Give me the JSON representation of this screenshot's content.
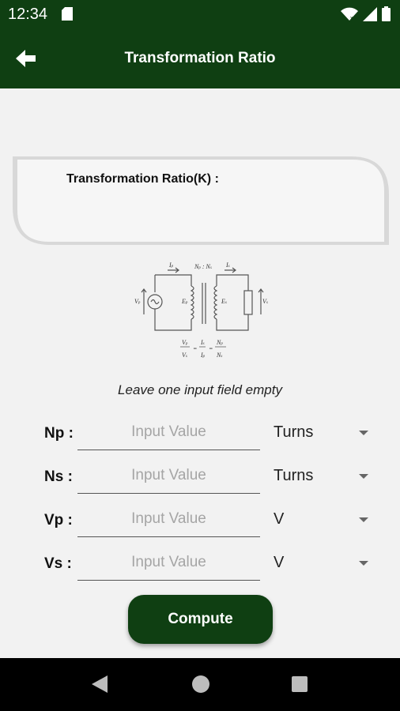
{
  "status_bar": {
    "time": "12:34"
  },
  "app_bar": {
    "title": "Transformation Ratio"
  },
  "result": {
    "label": "Transformation Ratio(K) :",
    "value": ""
  },
  "hint": "Leave one input field empty",
  "fields": [
    {
      "label": "Np :",
      "placeholder": "Input Value",
      "unit": "Turns"
    },
    {
      "label": "Ns :",
      "placeholder": "Input Value",
      "unit": "Turns"
    },
    {
      "label": "Vp :",
      "placeholder": "Input Value",
      "unit": "V"
    },
    {
      "label": "Vs :",
      "placeholder": "Input Value",
      "unit": "V"
    }
  ],
  "compute_label": "Compute",
  "colors": {
    "primary": "#0f3f12",
    "background": "#f2f2f2",
    "card": "#f5f5f5"
  },
  "icons": {
    "back": "arrow-left-icon",
    "wifi": "wifi-icon",
    "signal": "signal-icon",
    "battery": "battery-icon",
    "sd_card": "sd-card-icon"
  }
}
